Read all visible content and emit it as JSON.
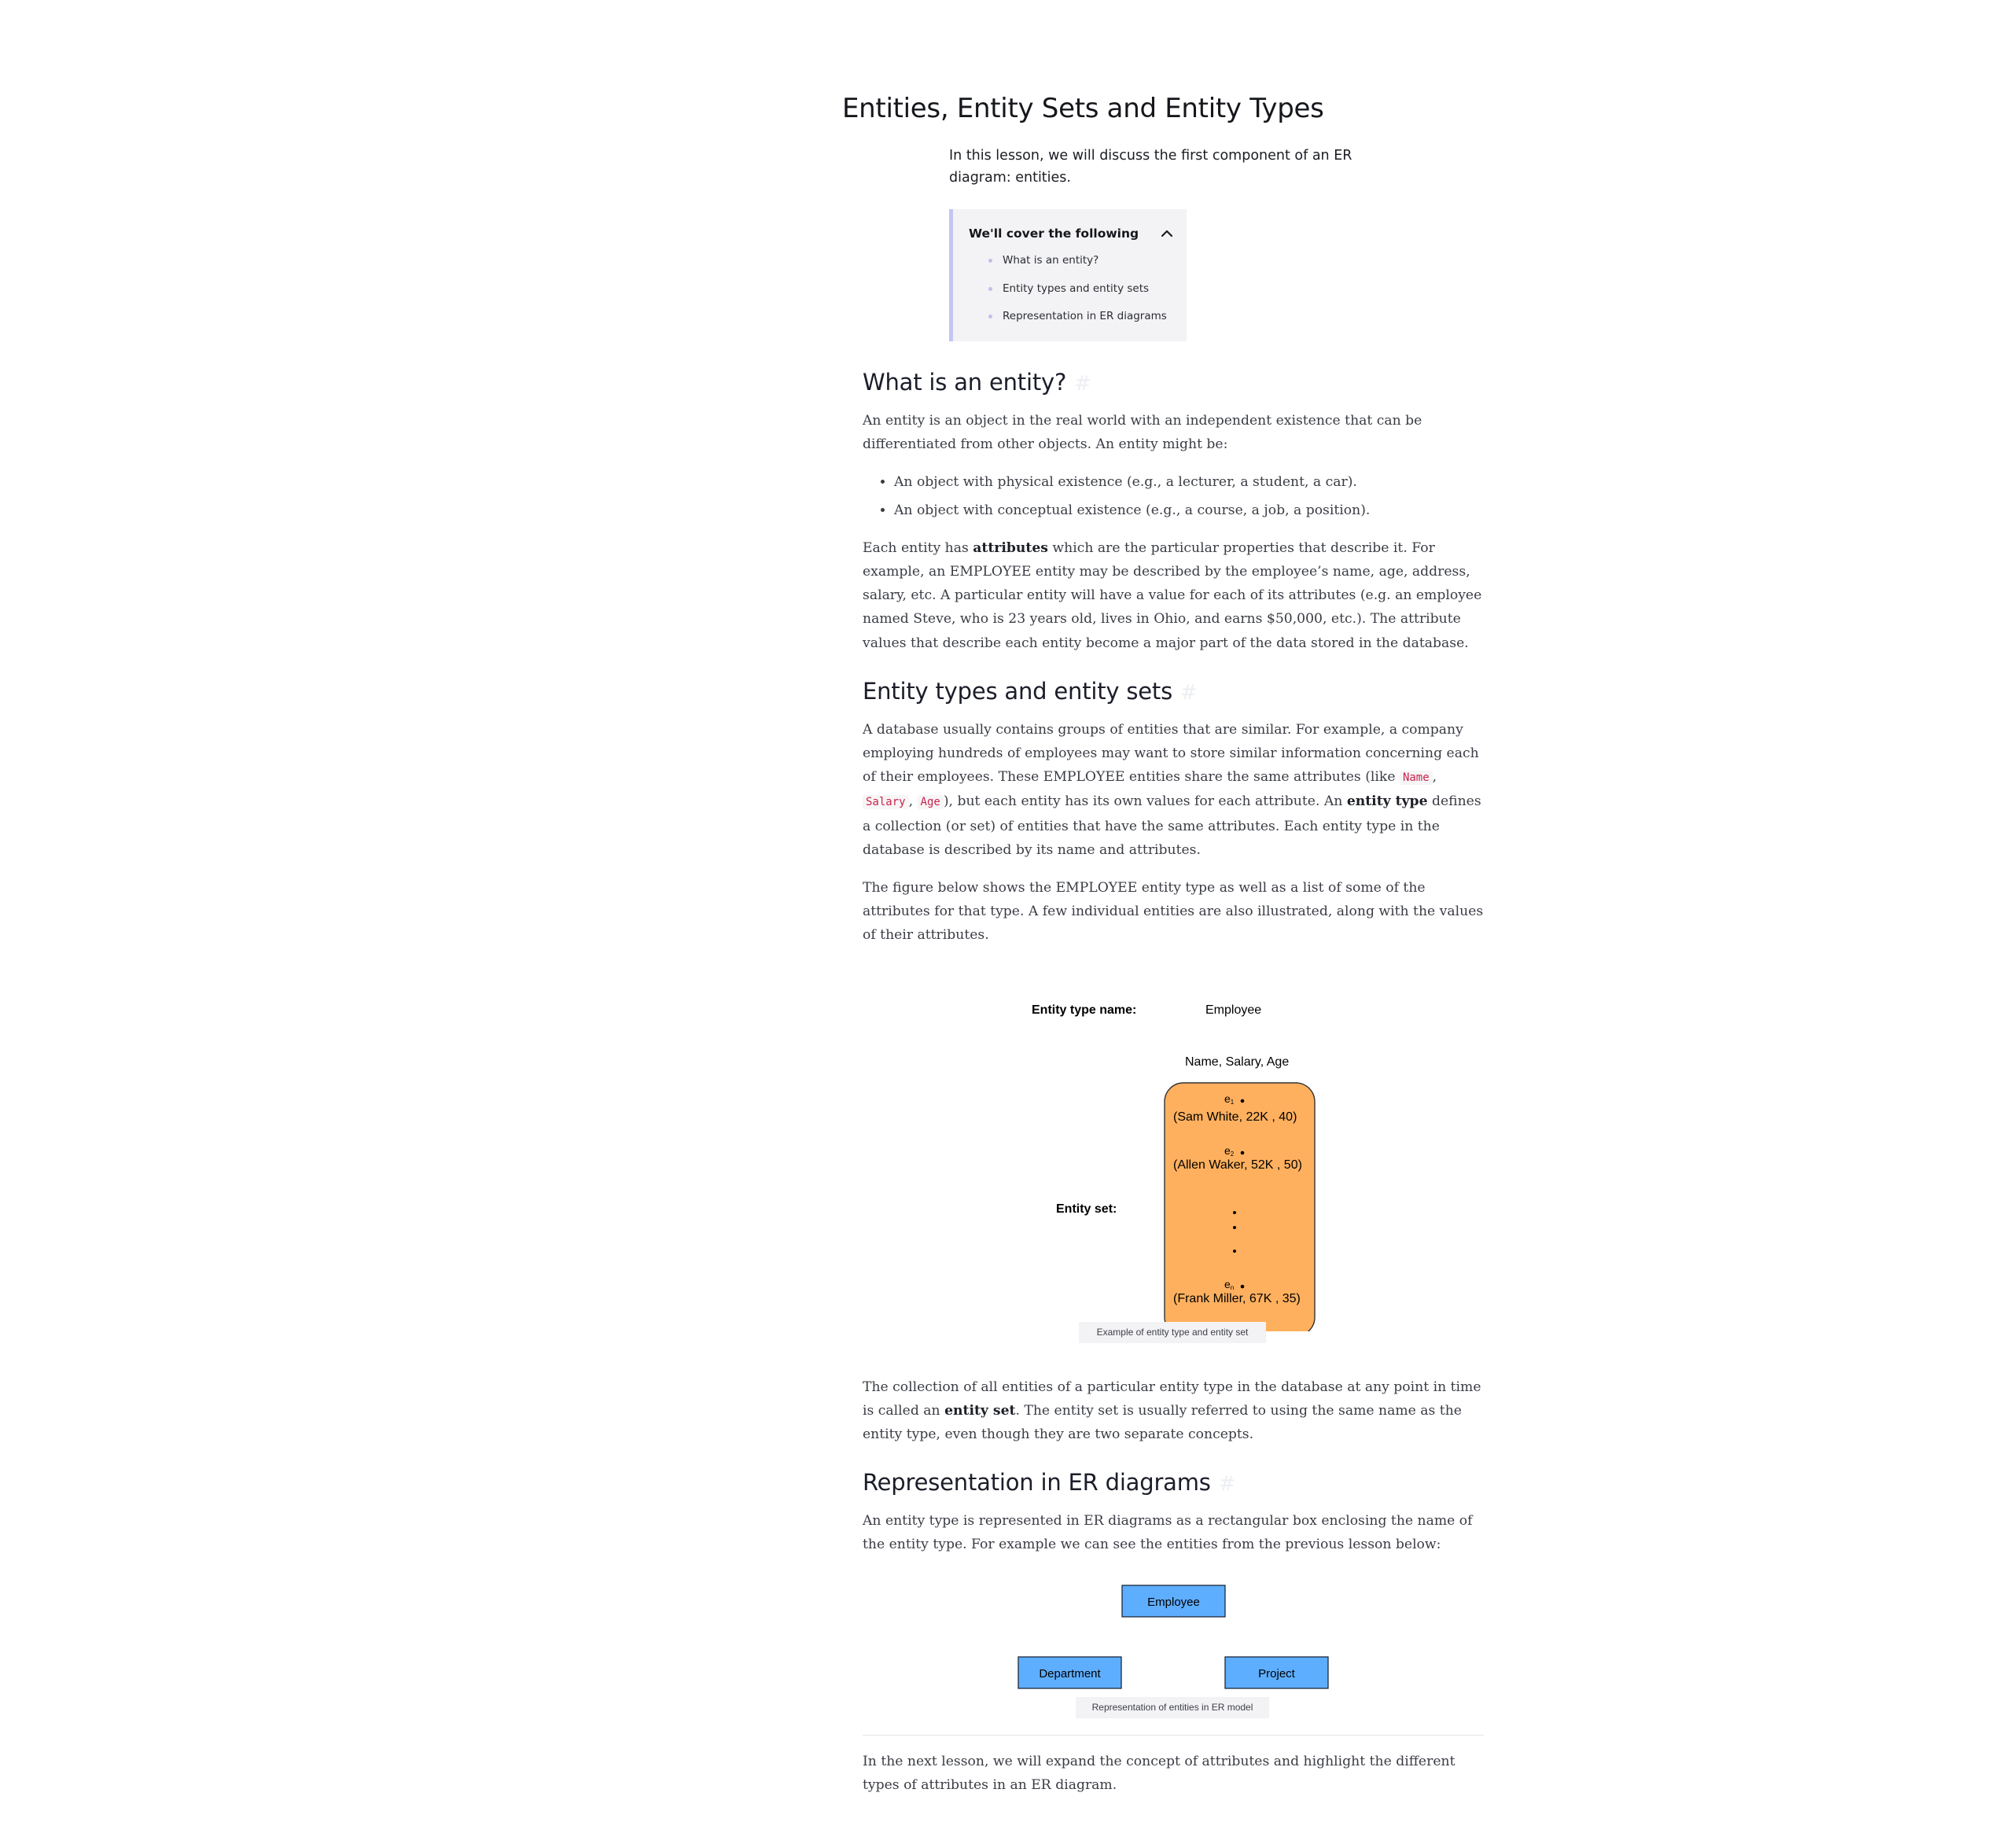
{
  "page": {
    "title": "Entities, Entity Sets and Entity Types",
    "intro": "In this lesson, we will discuss the first component of an ER diagram: entities."
  },
  "toc": {
    "title": "We'll cover the following",
    "items": [
      "What is an entity?",
      "Entity types and entity sets",
      "Representation in ER diagrams"
    ]
  },
  "section1": {
    "heading": "What is an entity?",
    "hash": "#",
    "p1": "An entity is an object in the real world with an independent existence that can be differentiated from other objects. An entity might be:",
    "bullets": [
      "An object with physical existence (e.g., a lecturer, a student, a car).",
      "An object with conceptual existence (e.g., a course, a job, a position)."
    ],
    "p2_before": "Each entity has ",
    "p2_bold": "attributes",
    "p2_after": " which are the particular properties that describe it. For example, an EMPLOYEE entity may be described by the employee’s name, age, address, salary, etc. A particular entity will have a value for each of its attributes (e.g. an employee named Steve, who is 23 years old, lives in Ohio, and earns $50,000, etc.). The attribute values that describe each entity become a major part of the data stored in the database."
  },
  "section2": {
    "heading": "Entity types and entity sets",
    "hash": "#",
    "p1_a": "A database usually contains groups of entities that are similar. For example, a company employing hundreds of employees may want to store similar information concerning each of their employees. These EMPLOYEE entities share the same attributes (like ",
    "code1": "Name",
    "sep1": ", ",
    "code2": "Salary",
    "sep2": ", ",
    "code3": "Age",
    "p1_b": "), but each entity has its own values for each attribute. An ",
    "p1_bold": "entity type",
    "p1_c": " defines a collection (or set) of entities that have the same attributes. Each entity type in the database is described by its name and attributes.",
    "p2": "The figure below shows the EMPLOYEE entity type as well as a list of some of the attributes for that type. A few individual entities are also illustrated, along with the values of their attributes.",
    "p3_a": "The collection of all entities of a particular entity type in the database at any point in time is called an ",
    "p3_bold": "entity set",
    "p3_b": ". The entity set is usually referred to using the same name as the entity type, even though they are two separate concepts."
  },
  "figure1": {
    "type_label": "Entity type name:",
    "type_value": "Employee",
    "attributes": "Name, Salary, Age",
    "set_label": "Entity set:",
    "entity_symbol": "e",
    "entities": [
      {
        "sub": "1",
        "value": "(Sam White, 22K , 40)"
      },
      {
        "sub": "2",
        "value": "(Allen Waker, 52K , 50)"
      },
      {
        "sub": "n",
        "value": "(Frank Miller, 67K , 35)"
      }
    ],
    "caption": "Example of entity type and entity set",
    "fill_color": "#ffb05e"
  },
  "section3": {
    "heading": "Representation in ER diagrams",
    "hash": "#",
    "p1": "An entity type is represented in ER diagrams as a rectangular box enclosing the name of the entity type. For example we can see the entities from the previous lesson below:"
  },
  "figure2": {
    "entities": [
      "Employee",
      "Department",
      "Project"
    ],
    "caption": "Representation of entities in ER model",
    "fill_color": "#5eaeff"
  },
  "closing": "In the next lesson, we will expand the concept of attributes and highlight the different types of attributes in an ER diagram."
}
